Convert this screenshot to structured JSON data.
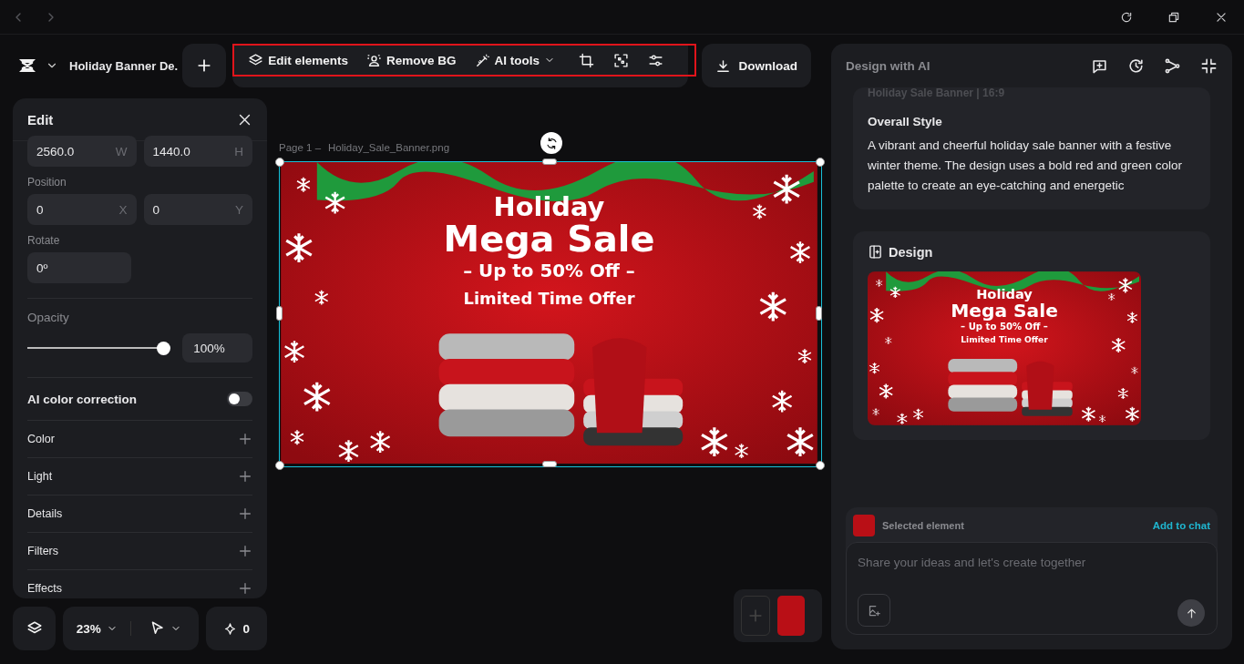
{
  "header": {
    "title": "Holiday Banner De.",
    "download": "Download"
  },
  "toolbar": [
    {
      "kind": "layers",
      "label": "Edit elements",
      "dropdown": false
    },
    {
      "kind": "person",
      "label": "Remove BG",
      "dropdown": false
    },
    {
      "kind": "wand",
      "label": "AI tools",
      "dropdown": true
    },
    {
      "kind": "crop"
    },
    {
      "kind": "scan"
    },
    {
      "kind": "sliders"
    }
  ],
  "edit_panel": {
    "title": "Edit",
    "size": [
      {
        "value": "2560.0",
        "axis": "W"
      },
      {
        "value": "1440.0",
        "axis": "H"
      }
    ],
    "position_label": "Position",
    "position": [
      {
        "value": "0",
        "axis": "X"
      },
      {
        "value": "0",
        "axis": "Y"
      }
    ],
    "rotate_label": "Rotate",
    "rotate": "0º",
    "opacity": {
      "label": "Opacity",
      "level": 1,
      "reading": "100%"
    },
    "ai_color": {
      "label": "AI color correction",
      "on": false
    },
    "sections": [
      "Color",
      "Light",
      "Details",
      "Filters",
      "Effects"
    ]
  },
  "canvas": {
    "page_label": "Page 1 –",
    "file_name": "Holiday_Sale_Banner.png",
    "banner": {
      "title": "Holiday",
      "headline": "Mega Sale",
      "offer": "– Up to 50% Off –",
      "tagline": "Limited Time Offer"
    }
  },
  "bottom_bar": {
    "zoom": "23%",
    "credits": "0"
  },
  "ai_panel": {
    "title": "Design with AI",
    "caption": "Holiday Sale Banner | 16:9",
    "style_heading": "Overall Style",
    "style_text": "A vibrant and cheerful holiday sale banner with a festive winter theme. The design uses a bold red and green color palette to create an eye-catching and energetic",
    "design_title": "Design",
    "design_banner": {
      "title": "Holiday",
      "headline": "Mega Sale",
      "offer": "– Up to 50% Off –",
      "tagline": "Limited Time Offer"
    },
    "selected_label": "Selected element",
    "add_link": "Add to chat",
    "placeholder": "Share your ideas and let's create together"
  }
}
